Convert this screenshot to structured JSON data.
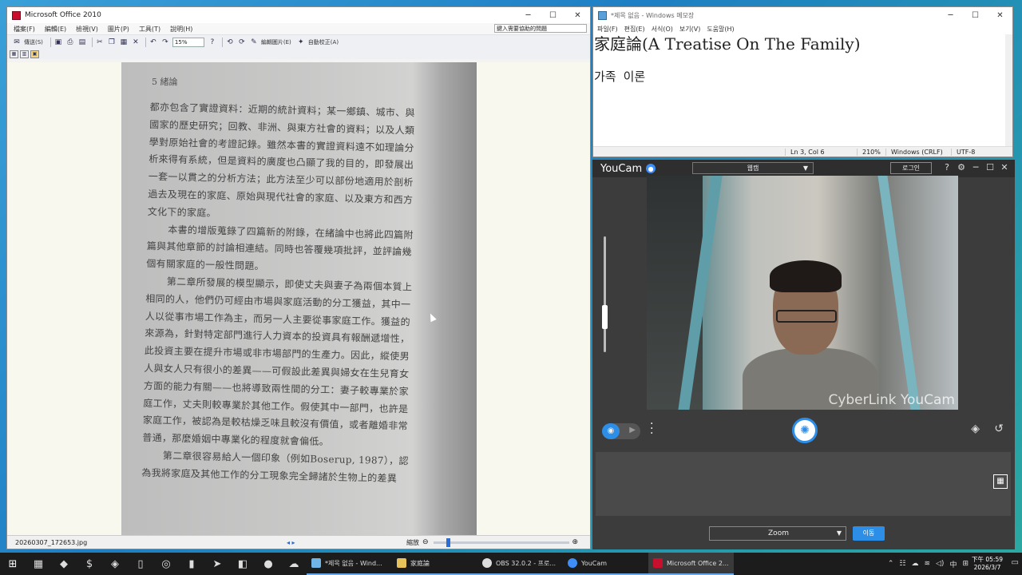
{
  "office": {
    "title": "Microsoft Office 2010",
    "menu": [
      "檔案(F)",
      "編輯(E)",
      "檢視(V)",
      "圖片(P)",
      "工具(T)",
      "說明(H)"
    ],
    "help_box": "鍵入需要協助的問題",
    "toolbar": {
      "send_label": "傳送(S)",
      "zoom_value": "15%",
      "edit_picture_label": "編輯圖片(E)",
      "autocorrect_label": "自動校正(A)"
    },
    "page": {
      "header": "5   緒論",
      "paragraphs": [
        "都亦包含了實證資料：近期的統計資料；某一鄉鎮、城市、與國家的歷史研究；回教、非洲、與東方社會的資料；以及人類學對原始社會的考證記錄。雖然本書的實證資料遠不如理論分析來得有系統，但是資料的廣度也凸顯了我的目的，即發展出一套一以貫之的分析方法；此方法至少可以部份地適用於剖析過去及現在的家庭、原始與現代社會的家庭、以及東方和西方文化下的家庭。",
        "本書的增版蒐錄了四篇新的附錄，在緒論中也將此四篇附篇與其他章節的討論相連結。同時也答覆幾項批評，並評論幾個有關家庭的一般性問題。",
        "第二章所發展的模型顯示，即使丈夫與妻子為兩個本質上相同的人，他們仍可經由市場與家庭活動的分工獲益，其中一人以從事市場工作為主，而另一人主要從事家庭工作。獲益的來源為，針對特定部門進行人力資本的投資具有報酬遞增性，此投資主要在提升市場或非市場部門的生產力。因此，縱使男人與女人只有很小的差異——可假設此差異與婦女在生兒育女方面的能力有關——也將導致兩性間的分工：妻子較專業於家庭工作，丈夫則較專業於其他工作。假使其中一部門，也許是家庭工作，被認為是較枯燥乏味且較沒有價值，或者離婚非常普通，那麼婚姻中專業化的程度就會偏低。",
        "第二章很容易給人一個印象（例如Boserup, 1987），認為我將家庭及其他工作的分工現象完全歸諸於生物上的差異"
      ]
    },
    "status": {
      "filename": "20260307_172653.jpg",
      "zoom_label": "縮放"
    }
  },
  "notepad": {
    "title": "*제목 없음 - Windows 메모장",
    "menu": [
      "파일(F)",
      "편집(E)",
      "서식(O)",
      "보기(V)",
      "도움말(H)"
    ],
    "lines": [
      "家庭論(A Treatise On The Family)",
      "가족 이론"
    ],
    "status": {
      "position": "Ln 3, Col 6",
      "zoom": "210%",
      "eol": "Windows (CRLF)",
      "encoding": "UTF-8"
    }
  },
  "youcam": {
    "brand": "YouCam",
    "device": "웹캠",
    "login": "로그인",
    "watermark": "CyberLink YouCam",
    "zoom_select": "Zoom",
    "go_label": "이동",
    "zoom_level": 0.75
  },
  "taskbar": {
    "tasks": [
      {
        "label": "*제목 없음 - Wind...",
        "color": "#6fb5e8"
      },
      {
        "label": "家庭論",
        "color": "#e8c35a"
      },
      {
        "label": "OBS 32.0.2 - 프로...",
        "color": "#dddddd"
      },
      {
        "label": "YouCam",
        "color": "#3e8ef7"
      },
      {
        "label": "Microsoft Office 2...",
        "color": "#c8102e"
      }
    ],
    "tray_lang": "中",
    "time": "下午 05:59",
    "date": "2026/3/7"
  }
}
